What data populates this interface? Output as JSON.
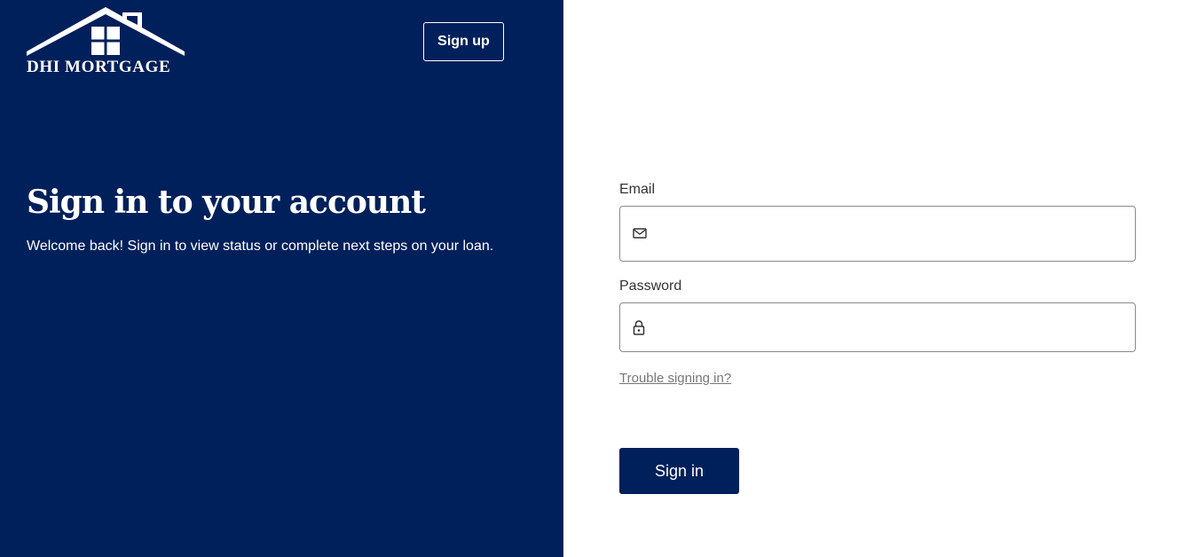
{
  "brand": {
    "logo_text": "DHI MORTGAGE",
    "logo_icon": "house-roof-window-icon",
    "primary_color": "#00205b"
  },
  "header": {
    "signup_label": "Sign up"
  },
  "hero": {
    "title": "Sign in to your account",
    "subtitle": "Welcome back! Sign in to view status or complete next steps on your loan."
  },
  "form": {
    "email": {
      "label": "Email",
      "value": "",
      "icon": "envelope-icon"
    },
    "password": {
      "label": "Password",
      "value": "",
      "icon": "lock-icon"
    },
    "trouble_link": "Trouble signing in?",
    "submit_label": "Sign in"
  }
}
